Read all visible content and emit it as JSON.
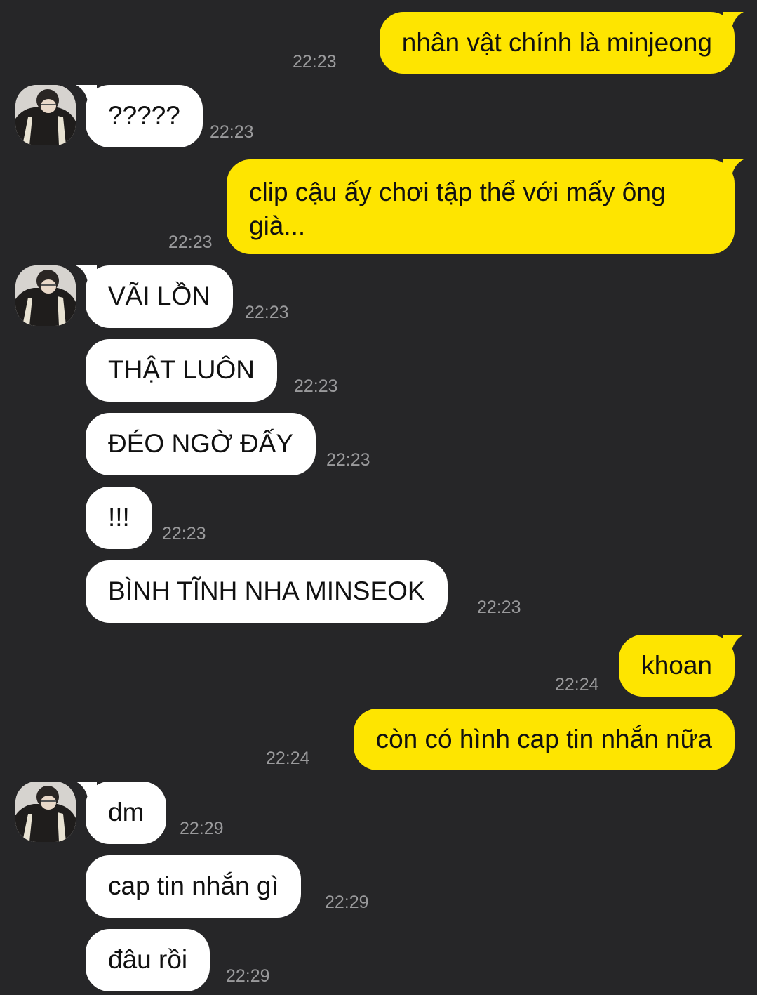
{
  "messages": [
    {
      "side": "out",
      "text": "nhân vật chính là minjeong",
      "time": "22:23"
    },
    {
      "side": "in",
      "text": "?????",
      "time": "22:23",
      "avatar": true
    },
    {
      "side": "out",
      "text": "clip cậu ấy chơi tập thể với mấy ông già...",
      "time": "22:23"
    },
    {
      "side": "in",
      "text": "VÃI LỒN",
      "time": "22:23",
      "avatar": true
    },
    {
      "side": "in",
      "text": "THẬT LUÔN",
      "time": "22:23"
    },
    {
      "side": "in",
      "text": "ĐÉO NGỜ ĐẤY",
      "time": "22:23"
    },
    {
      "side": "in",
      "text": "!!!",
      "time": "22:23"
    },
    {
      "side": "in",
      "text": "BÌNH TĨNH NHA MINSEOK",
      "time": "22:23"
    },
    {
      "side": "out",
      "text": "khoan",
      "time": "22:24"
    },
    {
      "side": "out",
      "text": "còn có hình cap tin nhắn nữa",
      "time": "22:24"
    },
    {
      "side": "in",
      "text": "dm",
      "time": "22:29",
      "avatar": true
    },
    {
      "side": "in",
      "text": "cap tin nhắn gì",
      "time": "22:29"
    },
    {
      "side": "in",
      "text": "đâu rồi",
      "time": "22:29"
    }
  ],
  "colors": {
    "background": "#262628",
    "outgoing_bubble": "#fee500",
    "incoming_bubble": "#ffffff",
    "timestamp": "#9a9a9c"
  }
}
